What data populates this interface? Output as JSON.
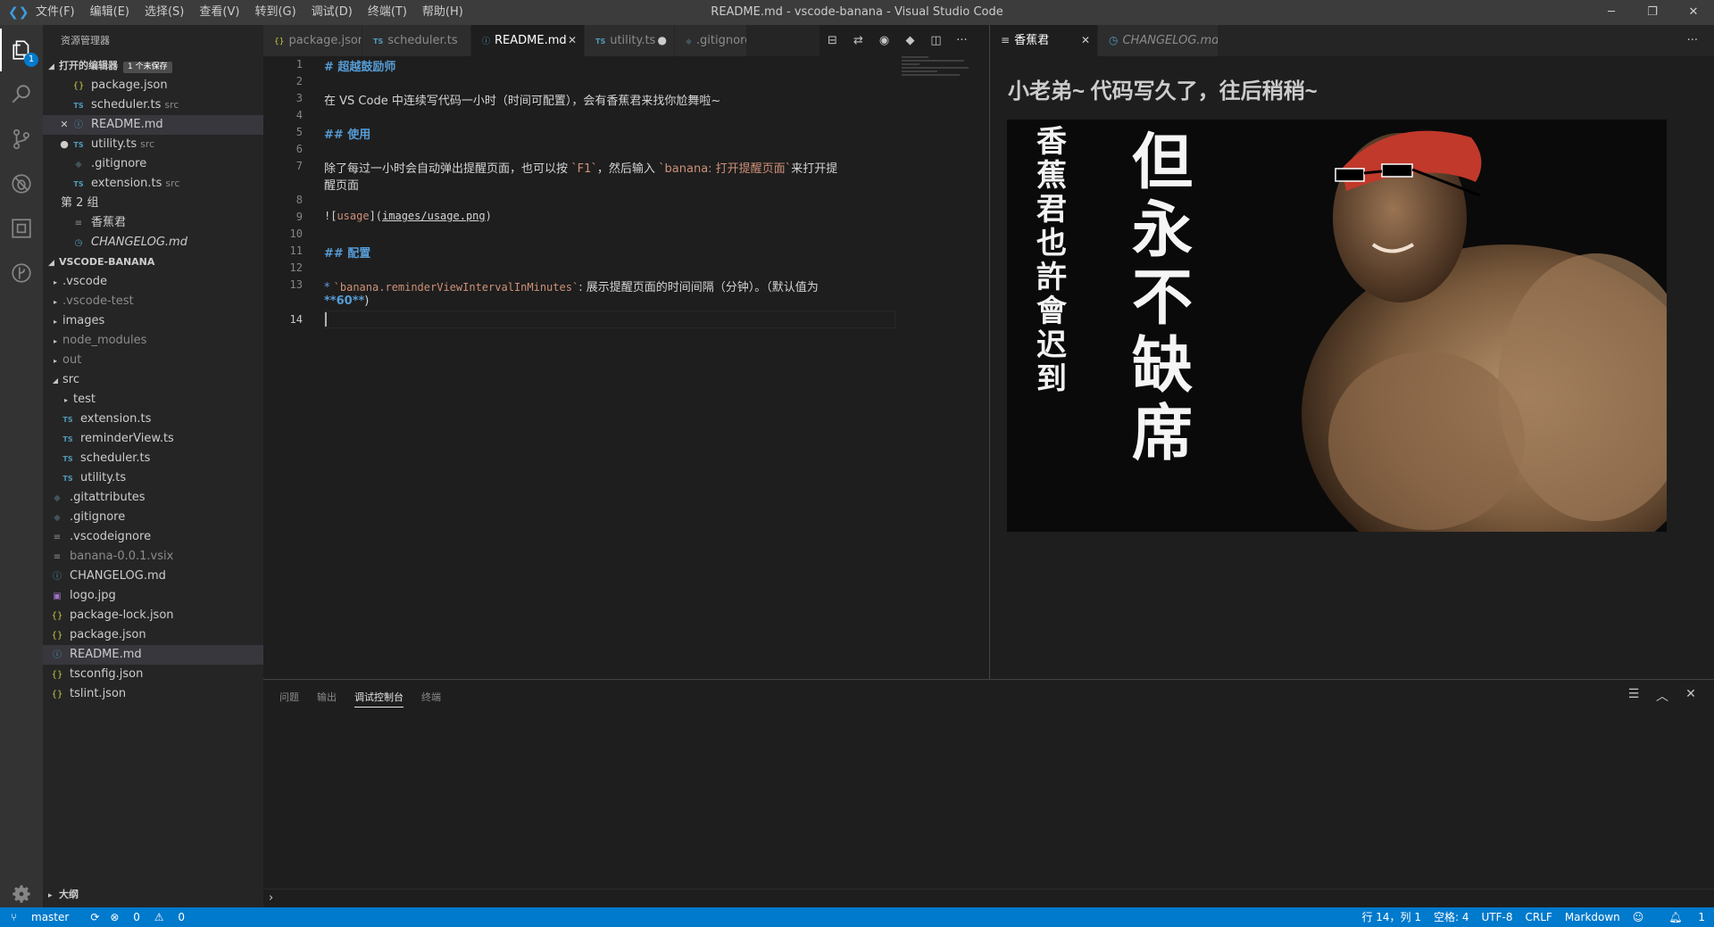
{
  "window": {
    "title": "README.md - vscode-banana - Visual Studio Code",
    "menu": [
      "文件(F)",
      "编辑(E)",
      "选择(S)",
      "查看(V)",
      "转到(G)",
      "调试(D)",
      "终端(T)",
      "帮助(H)"
    ],
    "controls": {
      "minimize": "─",
      "restore": "❐",
      "close": "✕"
    }
  },
  "activity_bar": {
    "items": [
      "explorer-icon",
      "search-icon",
      "source-control-icon",
      "debug-icon",
      "extensions-icon",
      "git-history-icon"
    ],
    "explorer_badge": "1",
    "settings": "gear-icon"
  },
  "sidebar": {
    "title": "资源管理器",
    "open_editors": {
      "header": "打开的编辑器",
      "dirty_badge": "1 个未保存",
      "group2_label": "第 2 组",
      "items": [
        {
          "name": "package.json",
          "desc": "",
          "icon": "{}",
          "kind": "json",
          "lead": ""
        },
        {
          "name": "scheduler.ts",
          "desc": "src",
          "icon": "TS",
          "kind": "ts",
          "lead": ""
        },
        {
          "name": "README.md",
          "desc": "",
          "icon": "ⓘ",
          "kind": "md",
          "lead": "✕"
        },
        {
          "name": "utility.ts",
          "desc": "src",
          "icon": "TS",
          "kind": "ts",
          "lead": "●"
        },
        {
          "name": ".gitignore",
          "desc": "",
          "icon": "◆",
          "kind": "git",
          "lead": ""
        },
        {
          "name": "extension.ts",
          "desc": "src",
          "icon": "TS",
          "kind": "ts",
          "lead": ""
        },
        {
          "name": "香蕉君",
          "desc": "",
          "icon": "≡",
          "kind": "lines",
          "lead": ""
        },
        {
          "name": "CHANGELOG.md",
          "desc": "",
          "icon": "◷",
          "kind": "md",
          "lead": ""
        }
      ]
    },
    "project": {
      "header": "VSCODE-BANANA",
      "items": [
        {
          "name": ".vscode",
          "type": "folder",
          "dim": false
        },
        {
          "name": ".vscode-test",
          "type": "folder",
          "dim": true
        },
        {
          "name": "images",
          "type": "folder",
          "dim": false
        },
        {
          "name": "node_modules",
          "type": "folder",
          "dim": true
        },
        {
          "name": "out",
          "type": "folder",
          "dim": true
        },
        {
          "name": "src",
          "type": "folder-open",
          "dim": false
        },
        {
          "name": "test",
          "type": "folder-nested",
          "dim": false
        },
        {
          "name": "extension.ts",
          "type": "ts",
          "dim": false
        },
        {
          "name": "reminderView.ts",
          "type": "ts",
          "dim": false
        },
        {
          "name": "scheduler.ts",
          "type": "ts",
          "dim": false
        },
        {
          "name": "utility.ts",
          "type": "ts",
          "dim": false
        },
        {
          "name": ".gitattributes",
          "type": "git",
          "dim": false
        },
        {
          "name": ".gitignore",
          "type": "git",
          "dim": false
        },
        {
          "name": ".vscodeignore",
          "type": "lines",
          "dim": false
        },
        {
          "name": "banana-0.0.1.vsix",
          "type": "lines",
          "dim": true
        },
        {
          "name": "CHANGELOG.md",
          "type": "md",
          "dim": false
        },
        {
          "name": "logo.jpg",
          "type": "img",
          "dim": false
        },
        {
          "name": "package-lock.json",
          "type": "json",
          "dim": false
        },
        {
          "name": "package.json",
          "type": "json",
          "dim": false
        },
        {
          "name": "README.md",
          "type": "md",
          "dim": false
        },
        {
          "name": "tsconfig.json",
          "type": "json",
          "dim": false
        },
        {
          "name": "tslint.json",
          "type": "json",
          "dim": false
        }
      ]
    },
    "outline_header": "大纲"
  },
  "editor_group_1": {
    "tabs": [
      {
        "label": "package.json",
        "icon": "{}",
        "active": false
      },
      {
        "label": "scheduler.ts",
        "icon": "TS",
        "active": false
      },
      {
        "label": "README.md",
        "icon": "ⓘ",
        "active": true
      },
      {
        "label": "utility.ts",
        "icon": "TS",
        "active": false,
        "dirty": true
      },
      {
        "label": ".gitignore",
        "icon": "◆",
        "active": false
      }
    ],
    "actions": [
      "⊟",
      "⇄",
      "◉",
      "◆",
      "◫",
      "···"
    ],
    "cursor_line": 14
  },
  "editor_group_2": {
    "tabs": [
      {
        "label": "香蕉君",
        "icon": "≡",
        "active": true
      },
      {
        "label": "CHANGELOG.md",
        "icon": "◷",
        "active": false
      }
    ],
    "more": "···",
    "reminder_title": "小老弟~ 代码写久了，往后稍稍~",
    "image_calligraphy_left": "香蕉君也許會迟到",
    "image_calligraphy_right": "但永不缺席"
  },
  "panel": {
    "tabs": [
      "问题",
      "输出",
      "调试控制台",
      "终端"
    ],
    "active_tab": "调试控制台",
    "prompt": "›"
  },
  "status_bar": {
    "branch": "master",
    "errors": "0",
    "warnings": "0",
    "position": "行 14，列 1",
    "spaces": "空格: 4",
    "encoding": "UTF-8",
    "eol": "CRLF",
    "language": "Markdown",
    "notifications": "1"
  }
}
